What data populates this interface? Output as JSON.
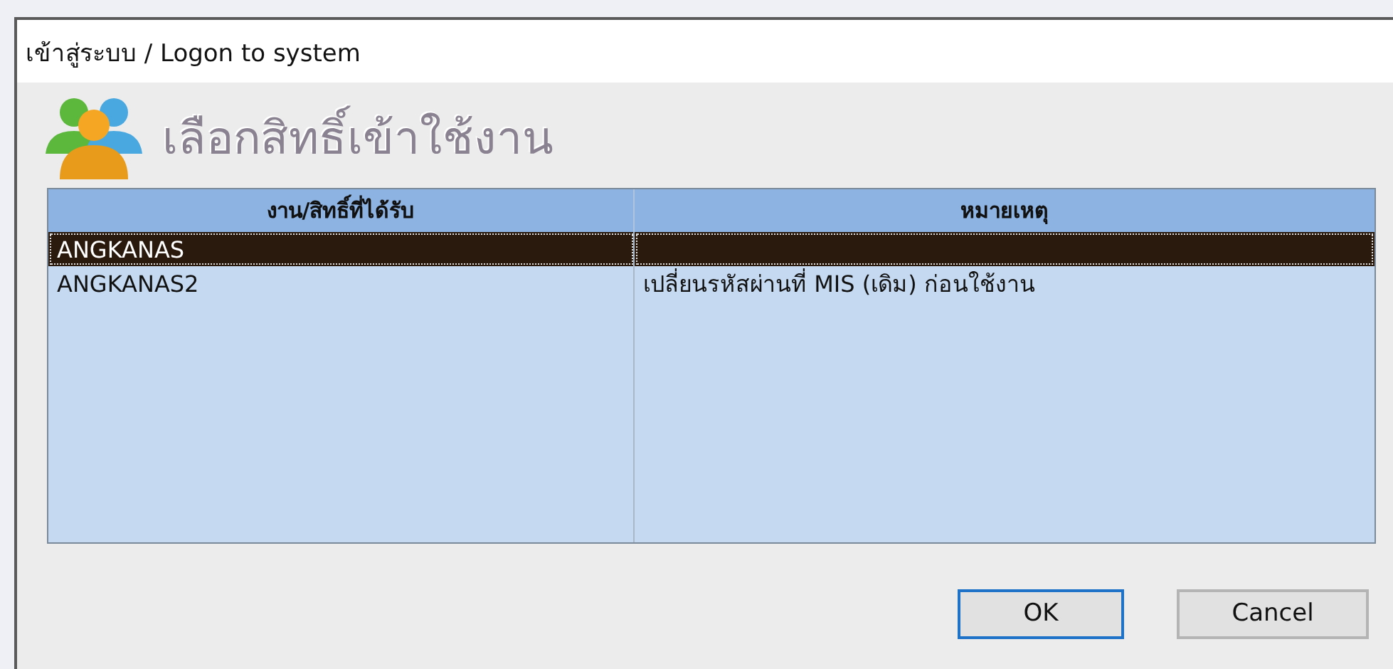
{
  "window": {
    "title": "เข้าสู่ระบบ / Logon to system"
  },
  "heading": "เลือกสิทธิ์เข้าใช้งาน",
  "table": {
    "columns": [
      "งาน/สิทธิ์ที่ได้รับ",
      "หมายเหตุ"
    ],
    "rows": [
      {
        "cells": [
          "ANGKANAS",
          ""
        ],
        "selected": true
      },
      {
        "cells": [
          "ANGKANAS2",
          "เปลี่ยนรหัสผ่านที่ MIS (เดิม) ก่อนใช้งาน"
        ],
        "selected": false
      }
    ]
  },
  "buttons": [
    {
      "label": "OK",
      "default": true
    },
    {
      "label": "Cancel",
      "default": false
    }
  ]
}
